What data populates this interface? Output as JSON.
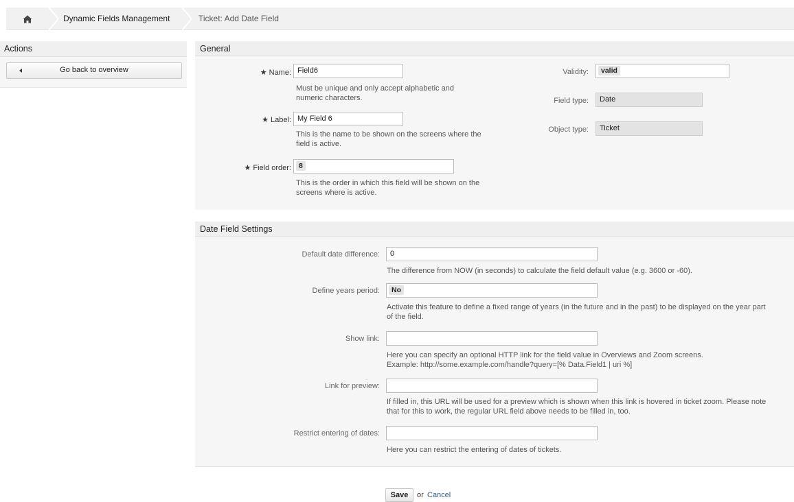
{
  "breadcrumb": {
    "home_icon": "home-icon",
    "items": [
      "Dynamic Fields Management",
      "Ticket: Add Date Field"
    ]
  },
  "sidebar": {
    "title": "Actions",
    "back_button": "Go back to overview"
  },
  "general": {
    "title": "General",
    "required_mark": "★",
    "name": {
      "label": "Name:",
      "value": "Field6",
      "hint": "Must be unique and only accept alphabetic and\nnumeric characters."
    },
    "label_field": {
      "label": "Label:",
      "value": "My Field 6",
      "hint": "This is the name to be shown on the screens where the\nfield is active."
    },
    "field_order": {
      "label": "Field order:",
      "value": "8",
      "hint": "This is the order in which this field will be shown on the\nscreens where is active."
    },
    "validity": {
      "label": "Validity:",
      "value": "valid"
    },
    "field_type": {
      "label": "Field type:",
      "value": "Date"
    },
    "object_type": {
      "label": "Object type:",
      "value": "Ticket"
    }
  },
  "date_settings": {
    "title": "Date Field Settings",
    "default_diff": {
      "label": "Default date difference:",
      "value": "0",
      "hint": "The difference from NOW (in seconds) to calculate the field default value (e.g. 3600 or -60)."
    },
    "years_period": {
      "label": "Define years period:",
      "value": "No",
      "hint": "Activate this feature to define a fixed range of years (in the future and in the past) to be displayed on the year part\nof the field."
    },
    "show_link": {
      "label": "Show link:",
      "value": "",
      "hint": "Here you can specify an optional HTTP link for the field value in Overviews and Zoom screens.\nExample: http://some.example.com/handle?query=[% Data.Field1 | uri %]"
    },
    "link_preview": {
      "label": "Link for preview:",
      "value": "",
      "hint": "If filled in, this URL will be used for a preview which is shown when this link is hovered in ticket zoom. Please note\nthat for this to work, the regular URL field above needs to be filled in, too."
    },
    "restrict_dates": {
      "label": "Restrict entering of dates:",
      "value": "",
      "hint": "Here you can restrict the entering of dates of tickets."
    }
  },
  "footer": {
    "save": "Save",
    "or": "or",
    "cancel": "Cancel"
  }
}
